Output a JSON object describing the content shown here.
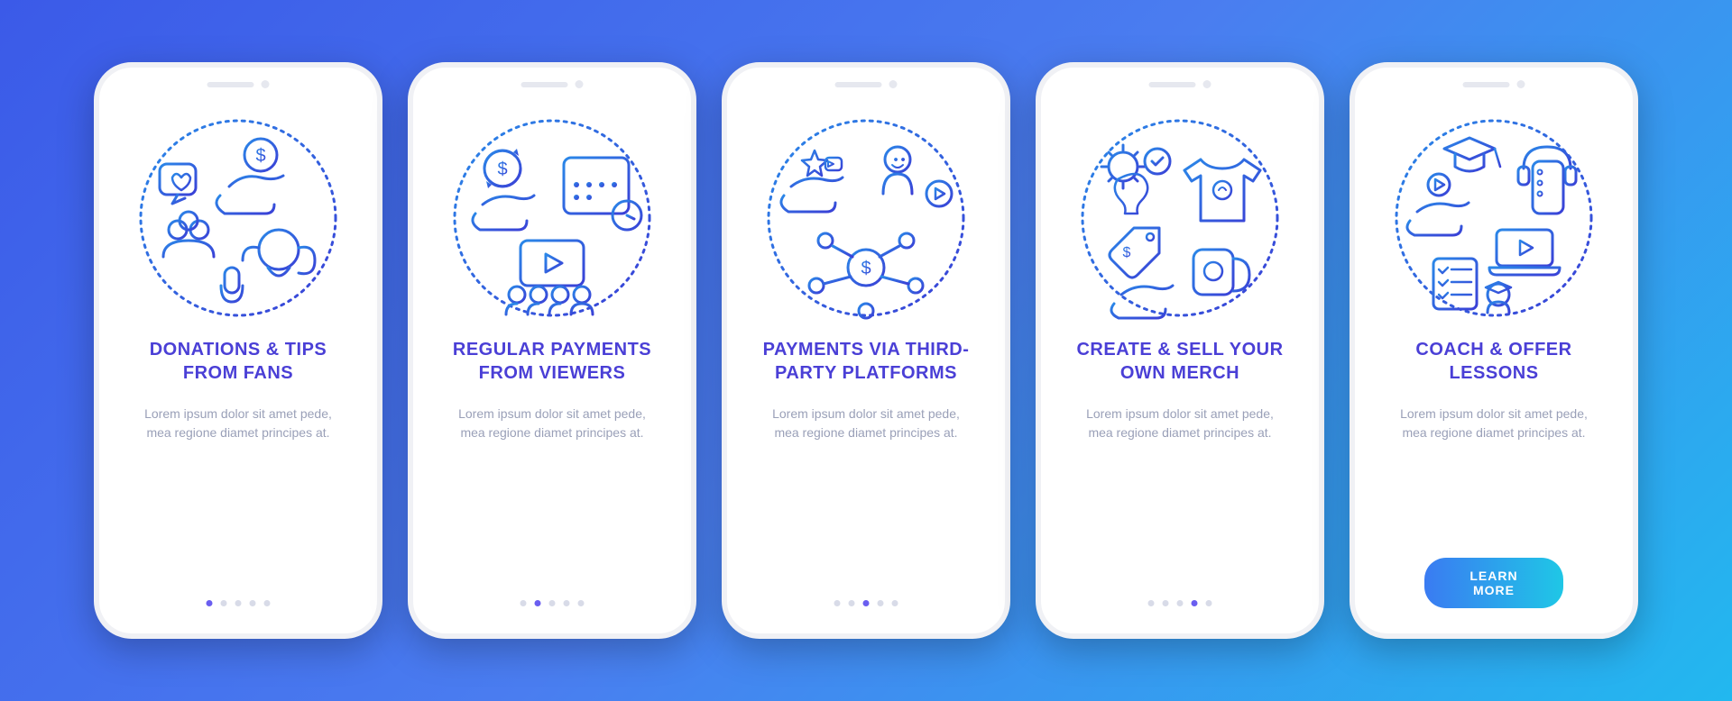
{
  "screens": [
    {
      "title": "DONATIONS & TIPS FROM FANS",
      "description": "Lorem ipsum dolor sit amet pede, mea regione diamet principes at.",
      "icon": "donations-icon",
      "activeDot": 0
    },
    {
      "title": "REGULAR PAYMENTS FROM VIEWERS",
      "description": "Lorem ipsum dolor sit amet pede, mea regione diamet principes at.",
      "icon": "regular-payments-icon",
      "activeDot": 1
    },
    {
      "title": "PAYMENTS VIA THIRD-PARTY PLATFORMS",
      "description": "Lorem ipsum dolor sit amet pede, mea regione diamet principes at.",
      "icon": "third-party-icon",
      "activeDot": 2
    },
    {
      "title": "CREATE & SELL YOUR OWN MERCH",
      "description": "Lorem ipsum dolor sit amet pede, mea regione diamet principes at.",
      "icon": "merch-icon",
      "activeDot": 3
    },
    {
      "title": "COACH & OFFER LESSONS",
      "description": "Lorem ipsum dolor sit amet pede, mea regione diamet principes at.",
      "icon": "coach-icon",
      "activeDot": 4
    }
  ],
  "cta": {
    "label": "LEARN MORE"
  },
  "dotCount": 5,
  "colors": {
    "stroke1": "#2a78e8",
    "stroke2": "#3a3fd6",
    "titleColor": "#4a3fd6",
    "descColor": "#9aa0b8",
    "ctaGradientStart": "#3a7bf2",
    "ctaGradientEnd": "#1fc7e6"
  }
}
